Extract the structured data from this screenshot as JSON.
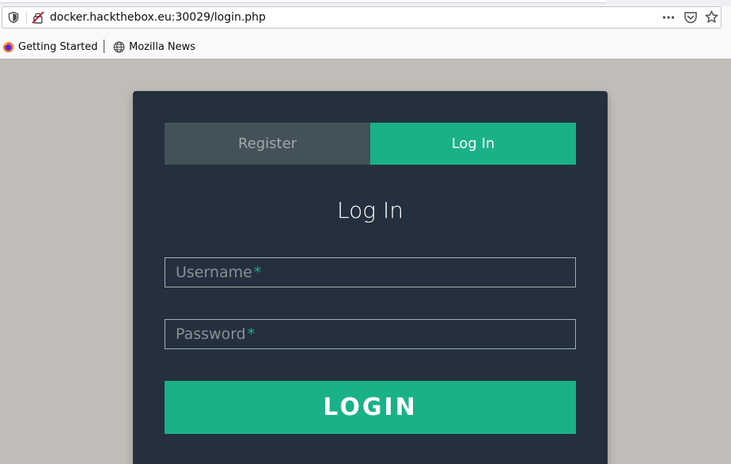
{
  "browser": {
    "url": "docker.hackthebox.eu:30029/login.php",
    "icons": {
      "tracking": "shield-icon",
      "insecure": "insecure-lock-icon",
      "page_actions": "more-horizontal-icon",
      "pocket": "pocket-icon",
      "bookmark": "star-icon"
    },
    "bookmarks": [
      {
        "label": "Getting Started",
        "icon": "firefox-icon"
      },
      {
        "label": "Mozilla News",
        "icon": "globe-icon"
      }
    ]
  },
  "page": {
    "tabs": [
      {
        "label": "Register",
        "active": false
      },
      {
        "label": "Log In",
        "active": true
      }
    ],
    "title": "Log In",
    "fields": {
      "username": {
        "label": "Username",
        "required_mark": "*",
        "value": ""
      },
      "password": {
        "label": "Password",
        "required_mark": "*",
        "value": ""
      }
    },
    "submit_label": "LOGIN"
  },
  "colors": {
    "page_bg": "#c0bcb7",
    "card_bg": "#24303d",
    "accent": "#1ab188",
    "inactive_tab": "#435159"
  }
}
